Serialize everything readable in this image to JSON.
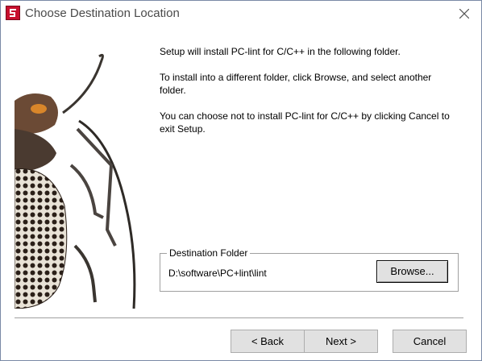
{
  "window": {
    "title": "Choose Destination Location",
    "app_icon": "setup-app-icon",
    "close_icon": "close-icon"
  },
  "art": {
    "icon": "longhorn-beetle-illustration"
  },
  "body": {
    "line1": "Setup will install PC-lint for C/C++ in the following folder.",
    "line2": "To install into a different folder, click Browse, and select another folder.",
    "line3": "You can choose not to install PC-lint for C/C++ by clicking Cancel to exit Setup."
  },
  "destination": {
    "legend": "Destination Folder",
    "path": "D:\\software\\PC+lint\\lint",
    "browse_label": "Browse..."
  },
  "buttons": {
    "back_label": "< Back",
    "next_label": "Next >",
    "cancel_label": "Cancel"
  }
}
